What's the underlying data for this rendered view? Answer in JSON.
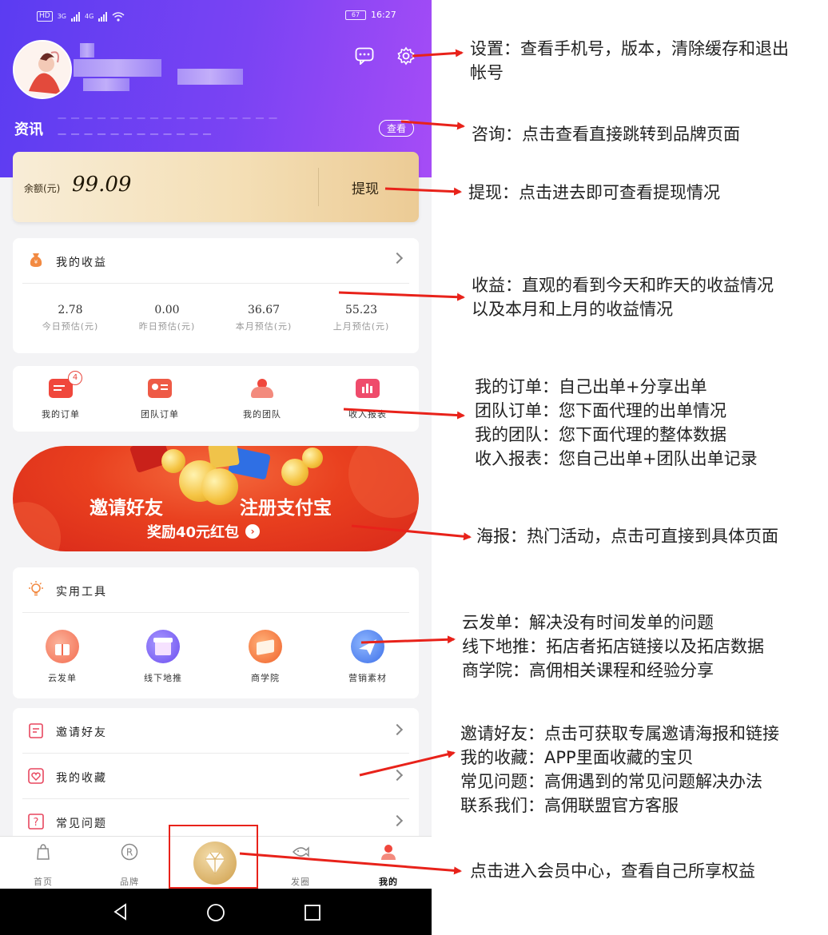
{
  "status_bar": {
    "hd": "HD",
    "net1": "3G",
    "net2": "4G",
    "battery": "67",
    "time": "16:27"
  },
  "header": {
    "news_label": "资讯",
    "news_button": "查看"
  },
  "balance": {
    "label": "余额(元)",
    "value": "99.09",
    "withdraw": "提现"
  },
  "earnings": {
    "title": "我的收益",
    "stats": [
      {
        "value": "2.78",
        "label": "今日预估(元)"
      },
      {
        "value": "0.00",
        "label": "昨日预估(元)"
      },
      {
        "value": "36.67",
        "label": "本月预估(元)"
      },
      {
        "value": "55.23",
        "label": "上月预估(元)"
      }
    ]
  },
  "quick_actions": [
    {
      "label": "我的订单",
      "badge": "4"
    },
    {
      "label": "团队订单"
    },
    {
      "label": "我的团队"
    },
    {
      "label": "收入报表"
    }
  ],
  "banner": {
    "left": "邀请好友",
    "right": "注册支付宝",
    "sub": "奖励40元红包"
  },
  "tools": {
    "title": "实用工具",
    "items": [
      {
        "label": "云发单"
      },
      {
        "label": "线下地推"
      },
      {
        "label": "商学院"
      },
      {
        "label": "营销素材"
      }
    ]
  },
  "menu": [
    {
      "label": "邀请好友"
    },
    {
      "label": "我的收藏"
    },
    {
      "label": "常见问题"
    }
  ],
  "tabbar": [
    {
      "label": "首页"
    },
    {
      "label": "品牌"
    },
    {
      "label": "发圈"
    },
    {
      "label": "我的"
    }
  ],
  "annotations": {
    "settings": [
      "设置：查看手机号，版本，清除缓存和退出",
      "帐号"
    ],
    "consult": [
      "咨询：点击查看直接跳转到品牌页面"
    ],
    "withdraw": [
      "提现：点击进去即可查看提现情况"
    ],
    "earnings": [
      "收益：直观的看到今天和昨天的收益情况",
      "以及本月和上月的收益情况"
    ],
    "orders": [
      "我的订单：自己出单+分享出单",
      "团队订单：您下面代理的出单情况",
      "我的团队：您下面代理的整体数据",
      "收入报表：您自己出单+团队出单记录"
    ],
    "poster": [
      "海报：热门活动，点击可直接到具体页面"
    ],
    "tools": [
      "云发单：解决没有时间发单的问题",
      "线下地推：拓店者拓店链接以及拓店数据",
      "商学院：高佣相关课程和经验分享"
    ],
    "menu": [
      "邀请好友：点击可获取专属邀请海报和链接",
      "我的收藏：APP里面收藏的宝贝",
      "常见问题：高佣遇到的常见问题解决办法",
      "联系我们：高佣联盟官方客服"
    ],
    "vip": [
      "点击进入会员中心，查看自己所享权益"
    ]
  },
  "colors": {
    "accent": "#6a3ff3",
    "arrow": "#e8221a",
    "gold": "#f4dfb6",
    "banner_red": "#e9401f"
  }
}
